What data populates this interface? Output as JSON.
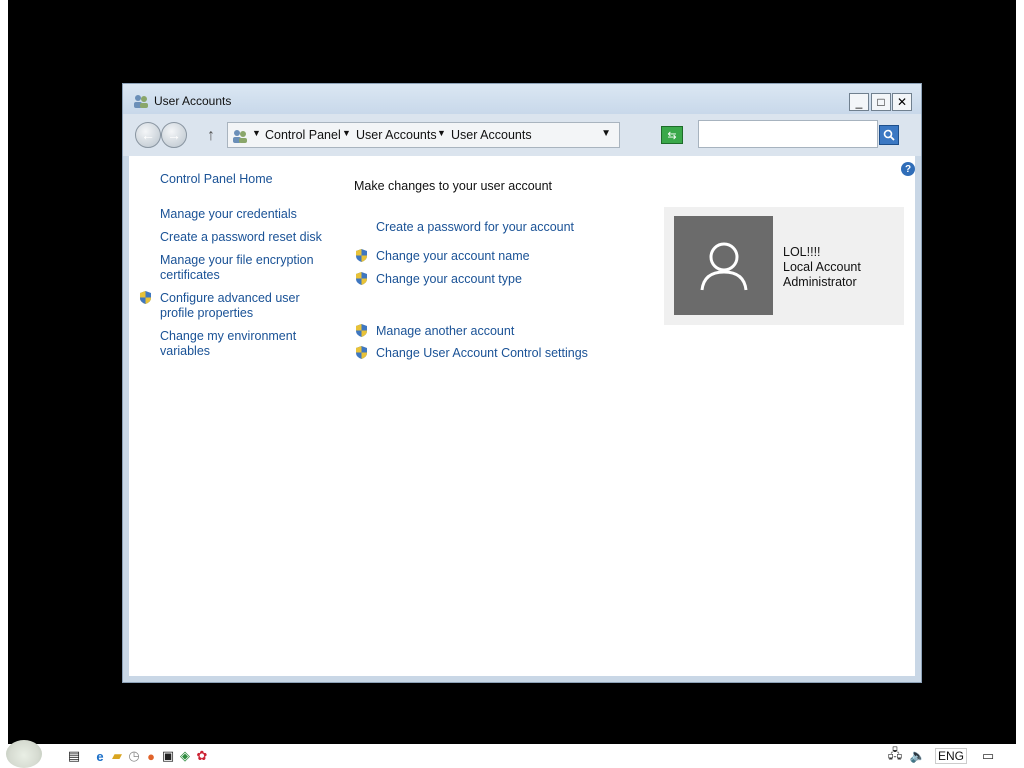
{
  "window": {
    "title": "User Accounts",
    "minimize": "_",
    "maximize": "□",
    "close": "✕"
  },
  "navbar": {
    "breadcrumbs": [
      "Control Panel",
      "User Accounts",
      "User Accounts"
    ],
    "search_placeholder": ""
  },
  "sidebar": {
    "items": [
      {
        "label": "Control Panel Home"
      },
      {
        "label": "Manage your credentials"
      },
      {
        "label": "Create a password reset disk"
      },
      {
        "label_line1": "Manage your file encryption",
        "label_line2": "certificates"
      },
      {
        "label_line1": "Configure advanced user",
        "label_line2": "profile properties",
        "shield": true
      },
      {
        "label_line1": "Change my environment",
        "label_line2": "variables"
      }
    ]
  },
  "main": {
    "heading": "Make changes to your user account",
    "tasks": [
      {
        "label": "Create a password for your account",
        "shield": false
      },
      {
        "label": "Change your account name",
        "shield": true
      },
      {
        "label": "Change your account type",
        "shield": true
      },
      {
        "label": "Manage another account",
        "shield": true
      },
      {
        "label": "Change User Account Control settings",
        "shield": true
      }
    ]
  },
  "account": {
    "name": "LOL!!!!",
    "type": "Local Account",
    "role": "Administrator"
  },
  "taskbar": {
    "language": "ENG"
  },
  "colors": {
    "link": "#1a5296",
    "window_frame": "#c9d7e6",
    "avatar_bg": "#6b6b6b"
  }
}
